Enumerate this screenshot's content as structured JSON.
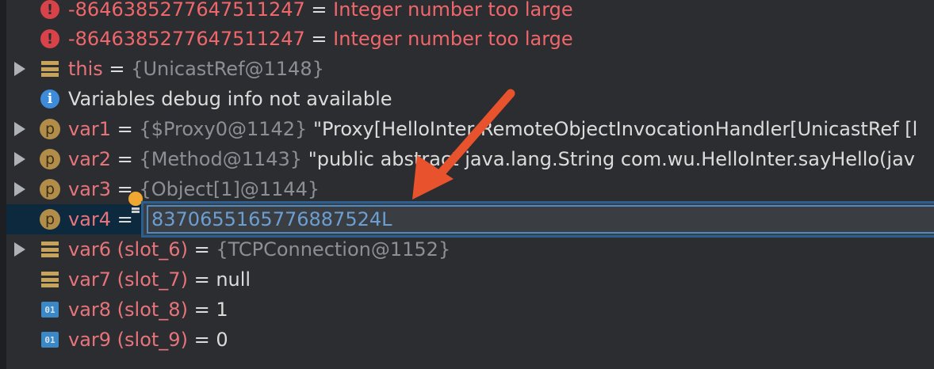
{
  "errors": [
    {
      "value": "-8646385277647511247",
      "eq": " = ",
      "message": "Integer number too large"
    },
    {
      "value": "-8646385277647511247",
      "eq": " = ",
      "message": "Integer number too large"
    }
  ],
  "this_row": {
    "name": "this",
    "eq": " = ",
    "value": "{UnicastRef@1148}"
  },
  "info_row": {
    "text": "Variables debug info not available"
  },
  "vars": [
    {
      "name": "var1",
      "eq": " = ",
      "ref": "{$Proxy0@1142}",
      "value": " \"Proxy[HelloInter,RemoteObjectInvocationHandler[UnicastRef [l"
    },
    {
      "name": "var2",
      "eq": " = ",
      "ref": "{Method@1143}",
      "value": " \"public abstract java.lang.String com.wu.HelloInter.sayHello(jav"
    },
    {
      "name": "var3",
      "eq": " = ",
      "ref": "{Object[1]@1144}",
      "value": ""
    },
    {
      "name": "var4",
      "eq": " = ",
      "ref": "",
      "value": ""
    },
    {
      "name": "var6 (slot_6)",
      "eq": " = ",
      "ref": "{TCPConnection@1152}",
      "value": ""
    },
    {
      "name": "var7 (slot_7)",
      "eq": " = ",
      "ref": "",
      "value": "null"
    },
    {
      "name": "var8 (slot_8)",
      "eq": " = ",
      "ref": "",
      "value": "1"
    },
    {
      "name": "var9 (slot_9)",
      "eq": " = ",
      "ref": "",
      "value": "0"
    }
  ],
  "editor": {
    "value": "8370655165776887524L"
  },
  "icons": {
    "error": "error-icon",
    "field": "field-icon",
    "info": "info-icon",
    "param": "parameter-icon",
    "primitive": "primitive-icon",
    "bulb": "intention-bulb-icon"
  },
  "icon_glyphs": {
    "error": "!",
    "info": "i",
    "param": "p",
    "primitive": "01"
  },
  "colors": {
    "accent_arrow": "#e8522c",
    "selection": "#0d293e",
    "name": "#e8747b",
    "error": "#f0676b"
  }
}
